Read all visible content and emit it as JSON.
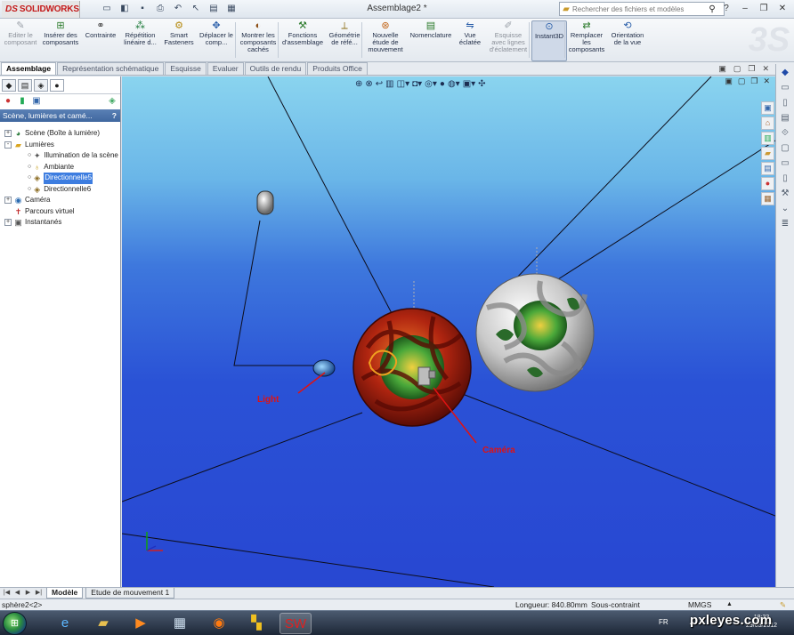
{
  "app": {
    "logo_prefix": "DS",
    "logo_name": "SOLIDWORKS",
    "window_title": "Assemblage2 *",
    "search_placeholder": "Rechercher des fichiers et modèles"
  },
  "ribbon": [
    {
      "label": "Editer le composant",
      "icon": "edit-component-icon",
      "disabled": true
    },
    {
      "label": "Insérer des composants",
      "icon": "insert-components-icon"
    },
    {
      "label": "Contrainte",
      "icon": "mate-icon"
    },
    {
      "label": "Répétition linéaire d...",
      "icon": "linear-pattern-icon"
    },
    {
      "label": "Smart Fasteners",
      "icon": "smart-fasteners-icon"
    },
    {
      "label": "Déplacer le comp...",
      "icon": "move-component-icon"
    },
    {
      "label": "Montrer les composants cachés",
      "icon": "show-hidden-icon"
    },
    {
      "label": "Fonctions d'assemblage",
      "icon": "assembly-features-icon"
    },
    {
      "label": "Géométrie de réfé...",
      "icon": "reference-geometry-icon"
    },
    {
      "label": "Nouvelle étude de mouvement",
      "icon": "motion-study-icon"
    },
    {
      "label": "Nomenclature",
      "icon": "bom-icon"
    },
    {
      "label": "Vue éclatée",
      "icon": "exploded-view-icon"
    },
    {
      "label": "Esquisse avec lignes d'éclatement",
      "icon": "explode-line-sketch-icon",
      "disabled": true
    },
    {
      "label": "Instant3D",
      "icon": "instant3d-icon",
      "active": true
    },
    {
      "label": "Remplacer les composants",
      "icon": "replace-components-icon"
    },
    {
      "label": "Orientation de la vue",
      "icon": "view-orientation-icon"
    }
  ],
  "tabs": [
    "Assemblage",
    "Représentation schématique",
    "Esquisse",
    "Evaluer",
    "Outils de rendu",
    "Produits Office"
  ],
  "active_tab": "Assemblage",
  "panel": {
    "header": "Scène, lumières et camé...",
    "help": "?",
    "tree": [
      {
        "label": "Scène (Boîte à lumière)",
        "level": 0,
        "toggle": "+",
        "icon": "scene-icon"
      },
      {
        "label": "Lumières",
        "level": 0,
        "toggle": "-",
        "icon": "lights-folder-icon"
      },
      {
        "label": "Illumination de la scène",
        "level": 1,
        "icon": "scene-illumination-icon"
      },
      {
        "label": "Ambiante",
        "level": 1,
        "icon": "ambient-light-icon"
      },
      {
        "label": "Directionnelle5",
        "level": 1,
        "icon": "directional-light-icon",
        "selected": true
      },
      {
        "label": "Directionnelle6",
        "level": 1,
        "icon": "directional-light-icon"
      },
      {
        "label": "Caméra",
        "level": 0,
        "toggle": "+",
        "icon": "camera-icon"
      },
      {
        "label": "Parcours virtuel",
        "level": 0,
        "icon": "walkthrough-icon"
      },
      {
        "label": "Instantanés",
        "level": 0,
        "toggle": "+",
        "icon": "snapshots-icon"
      }
    ]
  },
  "viewport": {
    "notes": {
      "light": "Light",
      "camera": "Caméra"
    },
    "colors": {
      "note": "#e01212",
      "red_sphere": "#c23010",
      "grey_sphere": "#d8d8d8",
      "green_core": "#3ca03a"
    }
  },
  "bottom_tabs": [
    "Modèle",
    "Etude de mouvement 1"
  ],
  "active_bottom_tab": "Modèle",
  "status": {
    "left": "sphère2<2>",
    "length": "Longueur: 840.80mm",
    "constraint": "Sous-contraint",
    "units": "MMGS",
    "units_arrow": "▲"
  },
  "taskbar": {
    "lang": "FR",
    "time": "18:33",
    "date": "29/05/2012",
    "watermark": "pxleyes.com"
  }
}
